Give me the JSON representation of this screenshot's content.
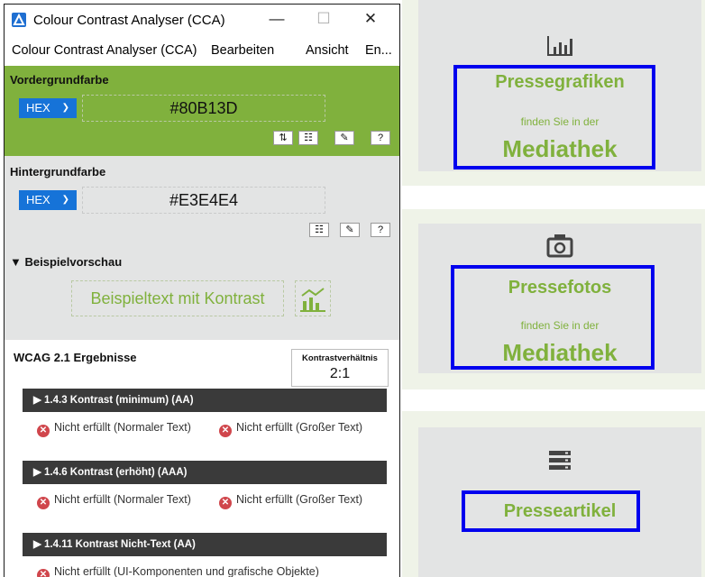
{
  "window": {
    "title": "Colour Contrast Analyser (CCA)",
    "controls": {
      "minimize": "—",
      "maximize": "☐",
      "close": "✕"
    }
  },
  "menu": [
    "Colour Contrast Analyser (CCA)",
    "Bearbeiten",
    "Ansicht",
    "En..."
  ],
  "foreground": {
    "label": "Vordergrundfarbe",
    "format": "HEX",
    "value": "#80B13D",
    "color": "#80b13d"
  },
  "background": {
    "label": "Hintergrundfarbe",
    "format": "HEX",
    "value": "#E3E4E4",
    "color": "#e3e4e4"
  },
  "preview": {
    "label": "▼ Beispielvorschau",
    "text": "Beispieltext mit Kontrast"
  },
  "results": {
    "label": "WCAG 2.1 Ergebnisse",
    "ratio_label": "Kontrastverhältnis",
    "ratio": "2:1",
    "criteria": [
      {
        "title": "▶ 1.4.3 Kontrast (minimum) (AA)",
        "normal": "Nicht erfüllt (Normaler Text)",
        "large": "Nicht erfüllt (Großer Text)"
      },
      {
        "title": "▶ 1.4.6 Kontrast (erhöht) (AAA)",
        "normal": "Nicht erfüllt (Normaler Text)",
        "large": "Nicht erfüllt (Großer Text)"
      },
      {
        "title": "▶ 1.4.11 Kontrast Nicht-Text (AA)",
        "ui": "Nicht erfüllt (UI-Komponenten und grafische Objekte)"
      }
    ]
  },
  "page_cards": [
    {
      "title": "Pressegrafiken",
      "subtitle": "finden Sie in der",
      "big": "Mediathek",
      "icon": "bar-chart-icon"
    },
    {
      "title": "Pressefotos",
      "subtitle": "finden Sie in der",
      "big": "Mediathek",
      "icon": "camera-icon"
    },
    {
      "title": "Presseartikel",
      "icon": "document-stack-icon"
    }
  ],
  "colors": {
    "accent_green": "#80b13d",
    "card_gray": "#e3e4e4",
    "highlight_blue": "#0000ee",
    "fail_red": "#d0464c"
  }
}
